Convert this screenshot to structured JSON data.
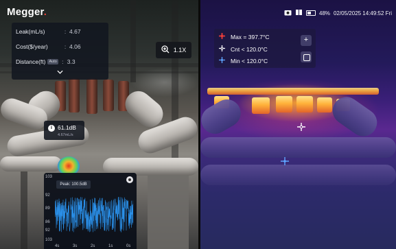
{
  "brand": {
    "name": "Megger",
    "dot": "."
  },
  "metrics": [
    {
      "label": "Leak(mL/s)",
      "value": "4.67",
      "auto": ""
    },
    {
      "label": "Cost($/year)",
      "value": "4.06",
      "auto": ""
    },
    {
      "label": "Distance(ft)",
      "value": "3.3",
      "auto": "Auto"
    }
  ],
  "zoom": {
    "label": "1.1X",
    "icon": "zoom-in-icon"
  },
  "detection": {
    "db": "61.1dB",
    "rate": "4.67mL/s",
    "info": "i"
  },
  "spectrum": {
    "peak_label": "Peak: 100.5dB",
    "y_ticks": [
      "103",
      "92",
      "89",
      "86",
      "92",
      "103"
    ],
    "x_ticks": [
      "4s",
      "3s",
      "2s",
      "1s",
      "0s"
    ]
  },
  "status": {
    "battery": "48%",
    "datetime": "02/05/2025 14:49:52 Fri",
    "icons": [
      "camera-icon",
      "book-icon",
      "battery-icon"
    ]
  },
  "thermal": {
    "max": "Max = 397.7°C",
    "cnt": "Cnt < 120.0°C",
    "min": "Min < 120.0°C",
    "plus": "+",
    "colors": {
      "max": "#e23b3b",
      "cnt": "#ffffff",
      "min": "#5fa4ff"
    }
  }
}
